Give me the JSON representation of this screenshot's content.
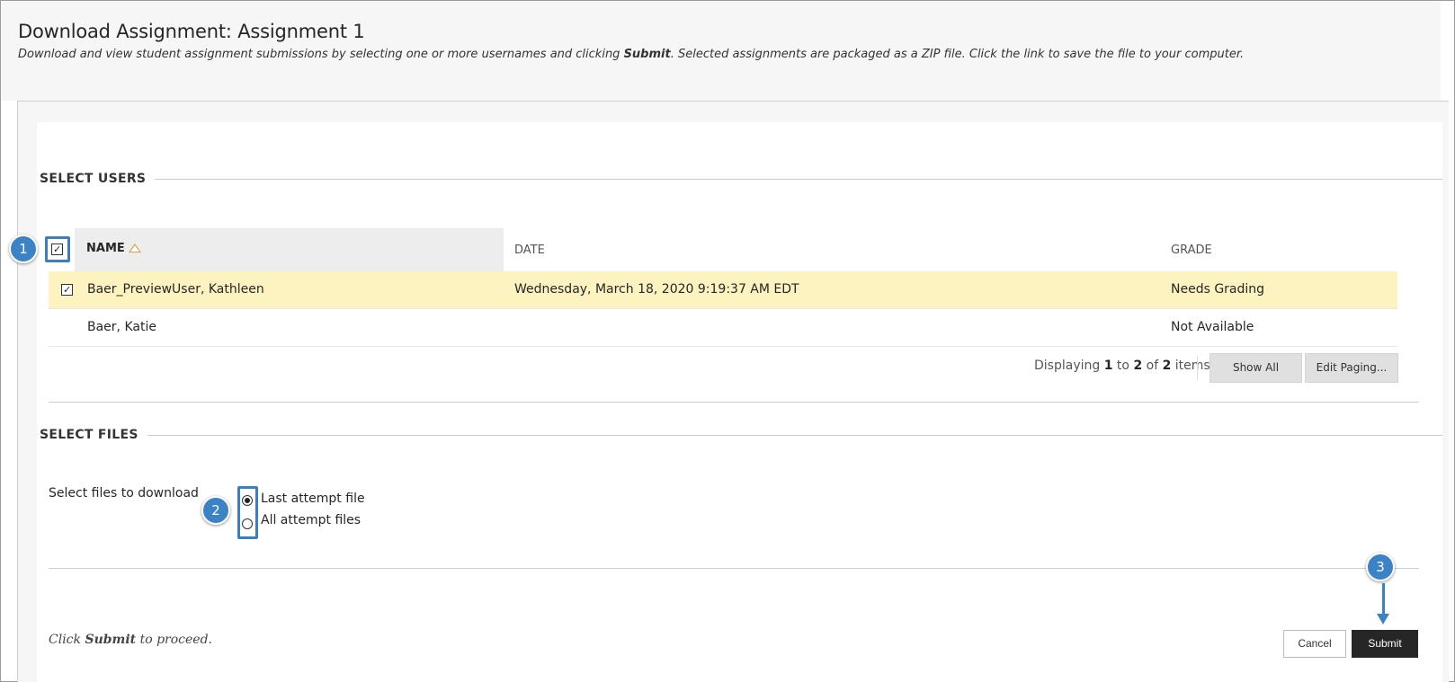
{
  "header": {
    "title": "Download Assignment: Assignment 1",
    "description_parts": {
      "before": "Download and view student assignment submissions by selecting one or more usernames and clicking ",
      "bold": "Submit",
      "after": ". Selected assignments are packaged as a ZIP file. Click the link to save the file to your computer."
    }
  },
  "select_users": {
    "section_title": "SELECT USERS",
    "columns": {
      "name": "NAME",
      "date": "DATE",
      "grade": "GRADE"
    },
    "select_all_checked": true,
    "rows": [
      {
        "name": "Baer_PreviewUser, Kathleen",
        "date": "Wednesday, March 18, 2020 9:19:37 AM EDT",
        "grade": "Needs Grading",
        "checked": true,
        "has_checkbox": true
      },
      {
        "name": "Baer, Katie",
        "date": "",
        "grade": "Not Available",
        "checked": false,
        "has_checkbox": false
      }
    ],
    "paging": {
      "prefix": "Displaying ",
      "start": "1",
      "mid1": " to ",
      "end": "2",
      "mid2": " of ",
      "total": "2",
      "suffix": " items",
      "show_all_label": "Show All",
      "edit_paging_label": "Edit Paging..."
    }
  },
  "select_files": {
    "section_title": "SELECT FILES",
    "field_label": "Select files to download",
    "options": [
      {
        "label": "Last attempt file",
        "checked": true
      },
      {
        "label": "All attempt files",
        "checked": false
      }
    ]
  },
  "footer": {
    "hint_before": "Click ",
    "hint_bold": "Submit",
    "hint_after": " to proceed.",
    "cancel_label": "Cancel",
    "submit_label": "Submit"
  },
  "callouts": [
    "1",
    "2",
    "3"
  ],
  "colors": {
    "accent": "#3b83c6",
    "selected_row": "#fdf3c1",
    "submit_button": "#262626",
    "header_bg": "#f6f6f6"
  }
}
